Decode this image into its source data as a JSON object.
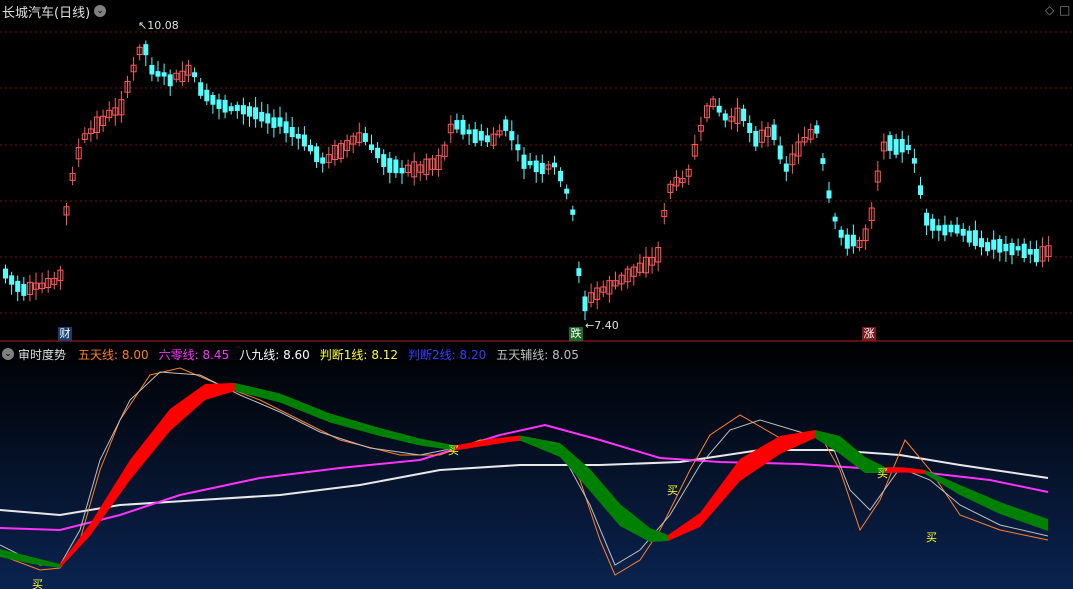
{
  "window": {
    "title": "长城汽车(日线)",
    "dropdown_glyph": "⌄",
    "ctrl_diamond": "◇",
    "ctrl_square": "□"
  },
  "price_chart": {
    "high_label": "10.08",
    "low_label": "7.40",
    "high_arrow": "↖",
    "low_arrow": "←",
    "markers": [
      {
        "text": "财",
        "color": "#1a3d6b"
      },
      {
        "text": "跌",
        "color": "#1a6b2a"
      },
      {
        "text": "涨",
        "color": "#7a1a1a"
      }
    ],
    "candle_up_color": "#ff5a5a",
    "candle_down_color": "#54ffff"
  },
  "indicator": {
    "name": "审时度势",
    "lines": [
      {
        "label": "五天线:",
        "value": "8.00",
        "color": "#ff7f27"
      },
      {
        "label": "六零线:",
        "value": "8.45",
        "color": "#ff33ff"
      },
      {
        "label": "八九线:",
        "value": "8.60",
        "color": "#ffffff"
      },
      {
        "label": "判断1线:",
        "value": "8.12",
        "color": "#ffff33"
      },
      {
        "label": "判断2线:",
        "value": "8.20",
        "color": "#3a3aff"
      },
      {
        "label": "五天辅线:",
        "value": "8.05",
        "color": "#bfbfbf"
      }
    ],
    "buy_label": "买",
    "band_up_color": "#ff0000",
    "band_down_color": "#008000"
  }
}
